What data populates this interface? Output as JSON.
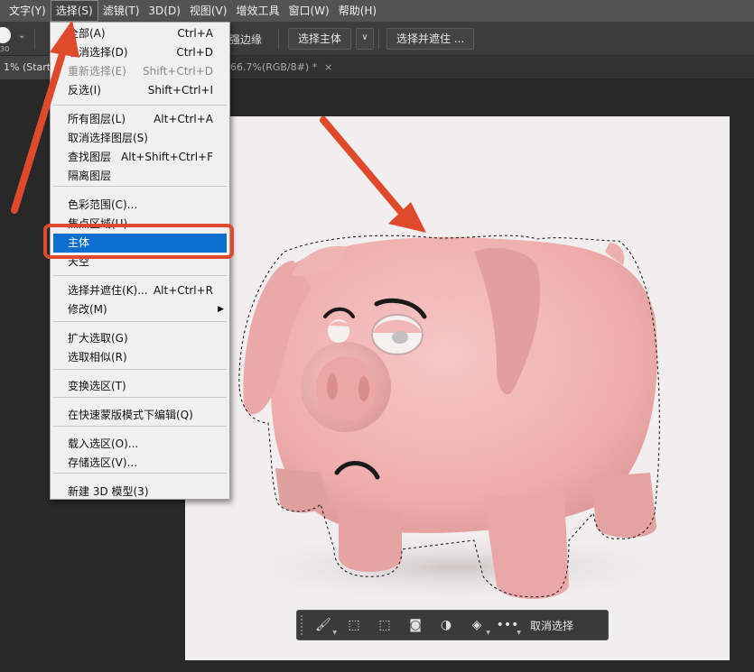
{
  "menubar": {
    "items": [
      "文字(Y)",
      "选择(S)",
      "滤镜(T)",
      "3D(D)",
      "视图(V)",
      "增效工具",
      "窗口(W)",
      "帮助(H)"
    ],
    "active_index": 1
  },
  "options_bar": {
    "brush_size": "30",
    "refine_edge_label": "强边缘",
    "select_subject_label": "选择主体",
    "select_and_mask_label": "选择并遮住 ..."
  },
  "tabs": {
    "first_tab": "1% (Start/",
    "second_tab": "66.7%(RGB/8#) *",
    "close_glyph": "×"
  },
  "dropdown": {
    "items": [
      {
        "label": "全部(A)",
        "shortcut": "Ctrl+A"
      },
      {
        "label": "取消选择(D)",
        "shortcut": "Ctrl+D"
      },
      {
        "label": "重新选择(E)",
        "shortcut": "Shift+Ctrl+D",
        "disabled": true
      },
      {
        "label": "反选(I)",
        "shortcut": "Shift+Ctrl+I"
      },
      {
        "label": "所有图层(L)",
        "shortcut": "Alt+Ctrl+A"
      },
      {
        "label": "取消选择图层(S)",
        "shortcut": ""
      },
      {
        "label": "查找图层",
        "shortcut": "Alt+Shift+Ctrl+F"
      },
      {
        "label": "隔离图层",
        "shortcut": ""
      },
      {
        "label": "色彩范围(C)...",
        "shortcut": ""
      },
      {
        "label": "焦点区域(U)...",
        "shortcut": ""
      },
      {
        "label": "主体",
        "shortcut": "",
        "highlighted": true
      },
      {
        "label": "天空",
        "shortcut": ""
      },
      {
        "label": "选择并遮住(K)...",
        "shortcut": "Alt+Ctrl+R"
      },
      {
        "label": "修改(M)",
        "shortcut": "",
        "submenu": true
      },
      {
        "label": "扩大选取(G)",
        "shortcut": ""
      },
      {
        "label": "选取相似(R)",
        "shortcut": ""
      },
      {
        "label": "变换选区(T)",
        "shortcut": ""
      },
      {
        "label": "在快速蒙版模式下编辑(Q)",
        "shortcut": ""
      },
      {
        "label": "载入选区(O)...",
        "shortcut": ""
      },
      {
        "label": "存储选区(V)...",
        "shortcut": ""
      },
      {
        "label": "新建 3D 模型(3)",
        "shortcut": ""
      }
    ]
  },
  "context_bar": {
    "icons": [
      "brush-refine-icon",
      "select-subject-icon",
      "transform-selection-icon",
      "mask-icon",
      "invert-icon",
      "fill-icon",
      "more-icon"
    ],
    "glyphs": [
      "🖌",
      "⬚",
      "⬚",
      "◙",
      "◑",
      "◈",
      "•••"
    ],
    "deselect_label": "取消选择"
  },
  "colors": {
    "menubar_bg": "#535353",
    "highlight_blue": "#0c6fd0",
    "annotation_red": "#e04a2c",
    "canvas_bg": "#f1eeef",
    "pig_pink": "#f2b9b9"
  }
}
